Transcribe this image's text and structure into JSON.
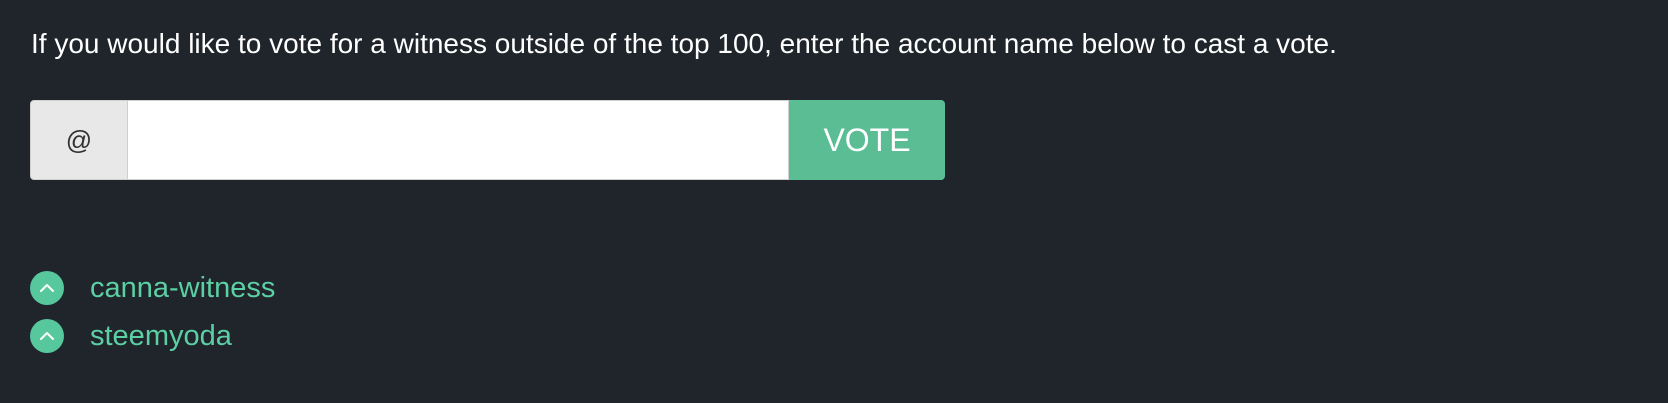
{
  "instructions": "If you would like to vote for a witness outside of the top 100, enter the account name below to cast a vote.",
  "vote_form": {
    "addon_symbol": "@",
    "input_value": "",
    "button_label": "VOTE"
  },
  "voted_witnesses": [
    {
      "name": "canna-witness",
      "icon": "chevron-up-icon"
    },
    {
      "name": "steemyoda",
      "icon": "chevron-up-icon"
    }
  ],
  "colors": {
    "background": "#1f252b",
    "accent": "#5bbd94",
    "link": "#5ccfa4"
  }
}
